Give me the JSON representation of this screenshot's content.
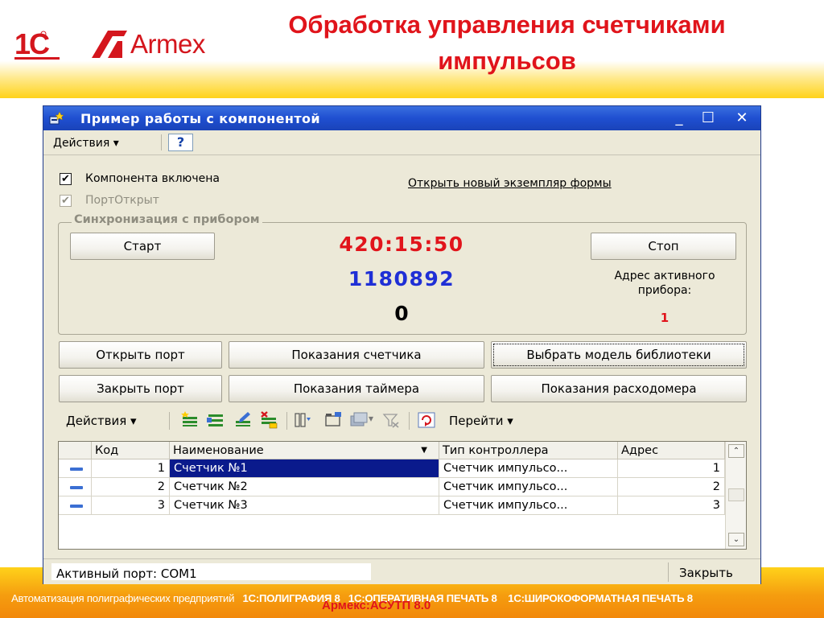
{
  "slide": {
    "title": "Обработка управления счетчиками импульсов",
    "logo_1c": "1С",
    "logo_armex": "Armex",
    "footer_left": "Автоматизация полиграфических предприятий",
    "footer_p1": "1С:ПОЛИГРАФИЯ 8",
    "footer_p2": "1С:ОПЕРАТИВНАЯ ПЕЧАТЬ 8",
    "footer_p3": "1С:ШИРОКОФОРМАТНАЯ ПЕЧАТЬ 8",
    "footer_sub": "Армекс:АСУТП 8.0",
    "colors": {
      "title_red": "#e0141b",
      "header_yellow": "#ffd21a",
      "footer_orange": "#f2880a"
    }
  },
  "window": {
    "title": "Пример работы с компонентой",
    "min_glyph": "_",
    "max_glyph": "☐",
    "close_glyph": "✕",
    "menu": {
      "actions": "Действия ▾",
      "help": "?"
    },
    "check_enabled": {
      "label": "Компонента включена",
      "mark": "✔"
    },
    "check_port": {
      "label": "ПортОткрыт",
      "mark": "✔"
    },
    "link_new_form": "Открыть новый экземпляр формы",
    "sync": {
      "legend": "Синхронизация с прибором",
      "start": "Старт",
      "stop": "Стоп",
      "timer": "420:15:50",
      "counter": "1180892",
      "zero": "0",
      "address_label": "Адрес активного прибора:",
      "address_value": "1"
    },
    "buttons": {
      "open_port": "Открыть порт",
      "close_port": "Закрыть порт",
      "meter_readings": "Показания счетчика",
      "timer_readings": "Показания таймера",
      "select_library": "Выбрать модель библиотеки",
      "flowmeter_readings": "Показания расходомера"
    },
    "toolbar": {
      "actions": "Действия ▾",
      "goto": "Перейти ▾",
      "icons": [
        "add-row-icon",
        "copy-row-icon",
        "edit-row-icon",
        "delete-row-icon",
        "filter-icon",
        "folder-icon",
        "list-icon",
        "clear-filter-icon",
        "refresh-icon"
      ]
    },
    "grid": {
      "columns": [
        "Код",
        "Наименование",
        "Тип контроллера",
        "Адрес"
      ],
      "sort_glyph": "▼",
      "rows": [
        {
          "code": "1",
          "name": "Счетчик №1",
          "type": "Счетчик импульсо...",
          "address": "1"
        },
        {
          "code": "2",
          "name": "Счетчик №2",
          "type": "Счетчик импульсо...",
          "address": "2"
        },
        {
          "code": "3",
          "name": "Счетчик №3",
          "type": "Счетчик импульсо...",
          "address": "3"
        }
      ]
    },
    "status": {
      "active_port": "Активный порт: COM1",
      "close": "Закрыть"
    }
  }
}
